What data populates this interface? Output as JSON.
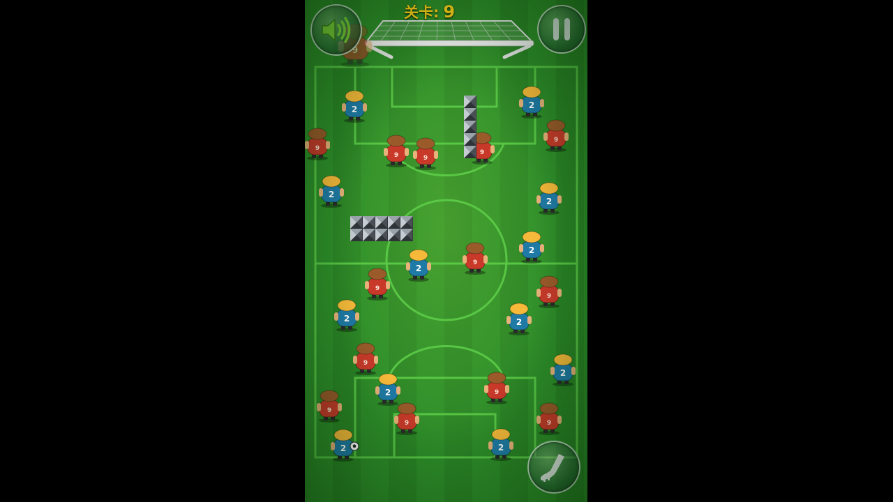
{
  "hud": {
    "level_label": "关卡:",
    "level_value": "9"
  },
  "buttons": {
    "sound_icon": "speaker-sound-on-icon",
    "pause_icon": "pause-icon",
    "kick_icon": "cleat-kick-icon"
  },
  "colors": {
    "pitch_green": "#2b8a28",
    "level_text": "#ffd21a",
    "blue_jersey": "#1f7aa6",
    "red_jersey": "#c9392a",
    "hair_blond": "#f6b93a",
    "hair_brown": "#9a5a2a"
  },
  "players": {
    "blue_number": "2",
    "red_number": "9"
  }
}
